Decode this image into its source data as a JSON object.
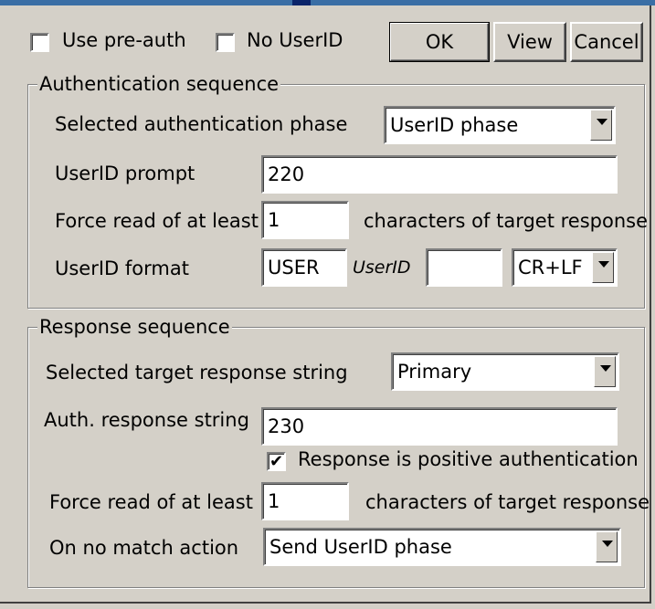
{
  "header": {
    "use_preauth": {
      "label": "Use pre-auth",
      "checked": false
    },
    "no_userid": {
      "label": "No UserID",
      "checked": false
    },
    "ok_label": "OK",
    "view_label": "View",
    "cancel_label": "Cancel"
  },
  "auth": {
    "legend": "Authentication sequence",
    "phase_label": "Selected authentication phase",
    "phase_value": "UserID phase",
    "prompt_label": "UserID prompt",
    "prompt_value": "220",
    "force_label": "Force read of at least",
    "force_value": "1",
    "force_suffix": "characters of target response",
    "format_label": "UserID format",
    "format_prefix": "USER",
    "format_token": "UserID",
    "format_suffix_value": "",
    "terminator_value": "CR+LF"
  },
  "response": {
    "legend": "Response sequence",
    "target_label": "Selected target response string",
    "target_value": "Primary",
    "string_label": "Auth. response string",
    "string_value": "230",
    "positive_label": "Response is positive authentication",
    "positive_checked": true,
    "force_label": "Force read of at least",
    "force_value": "1",
    "force_suffix": "characters of target response",
    "nomatch_label": "On no match action",
    "nomatch_value": "Send UserID phase"
  }
}
